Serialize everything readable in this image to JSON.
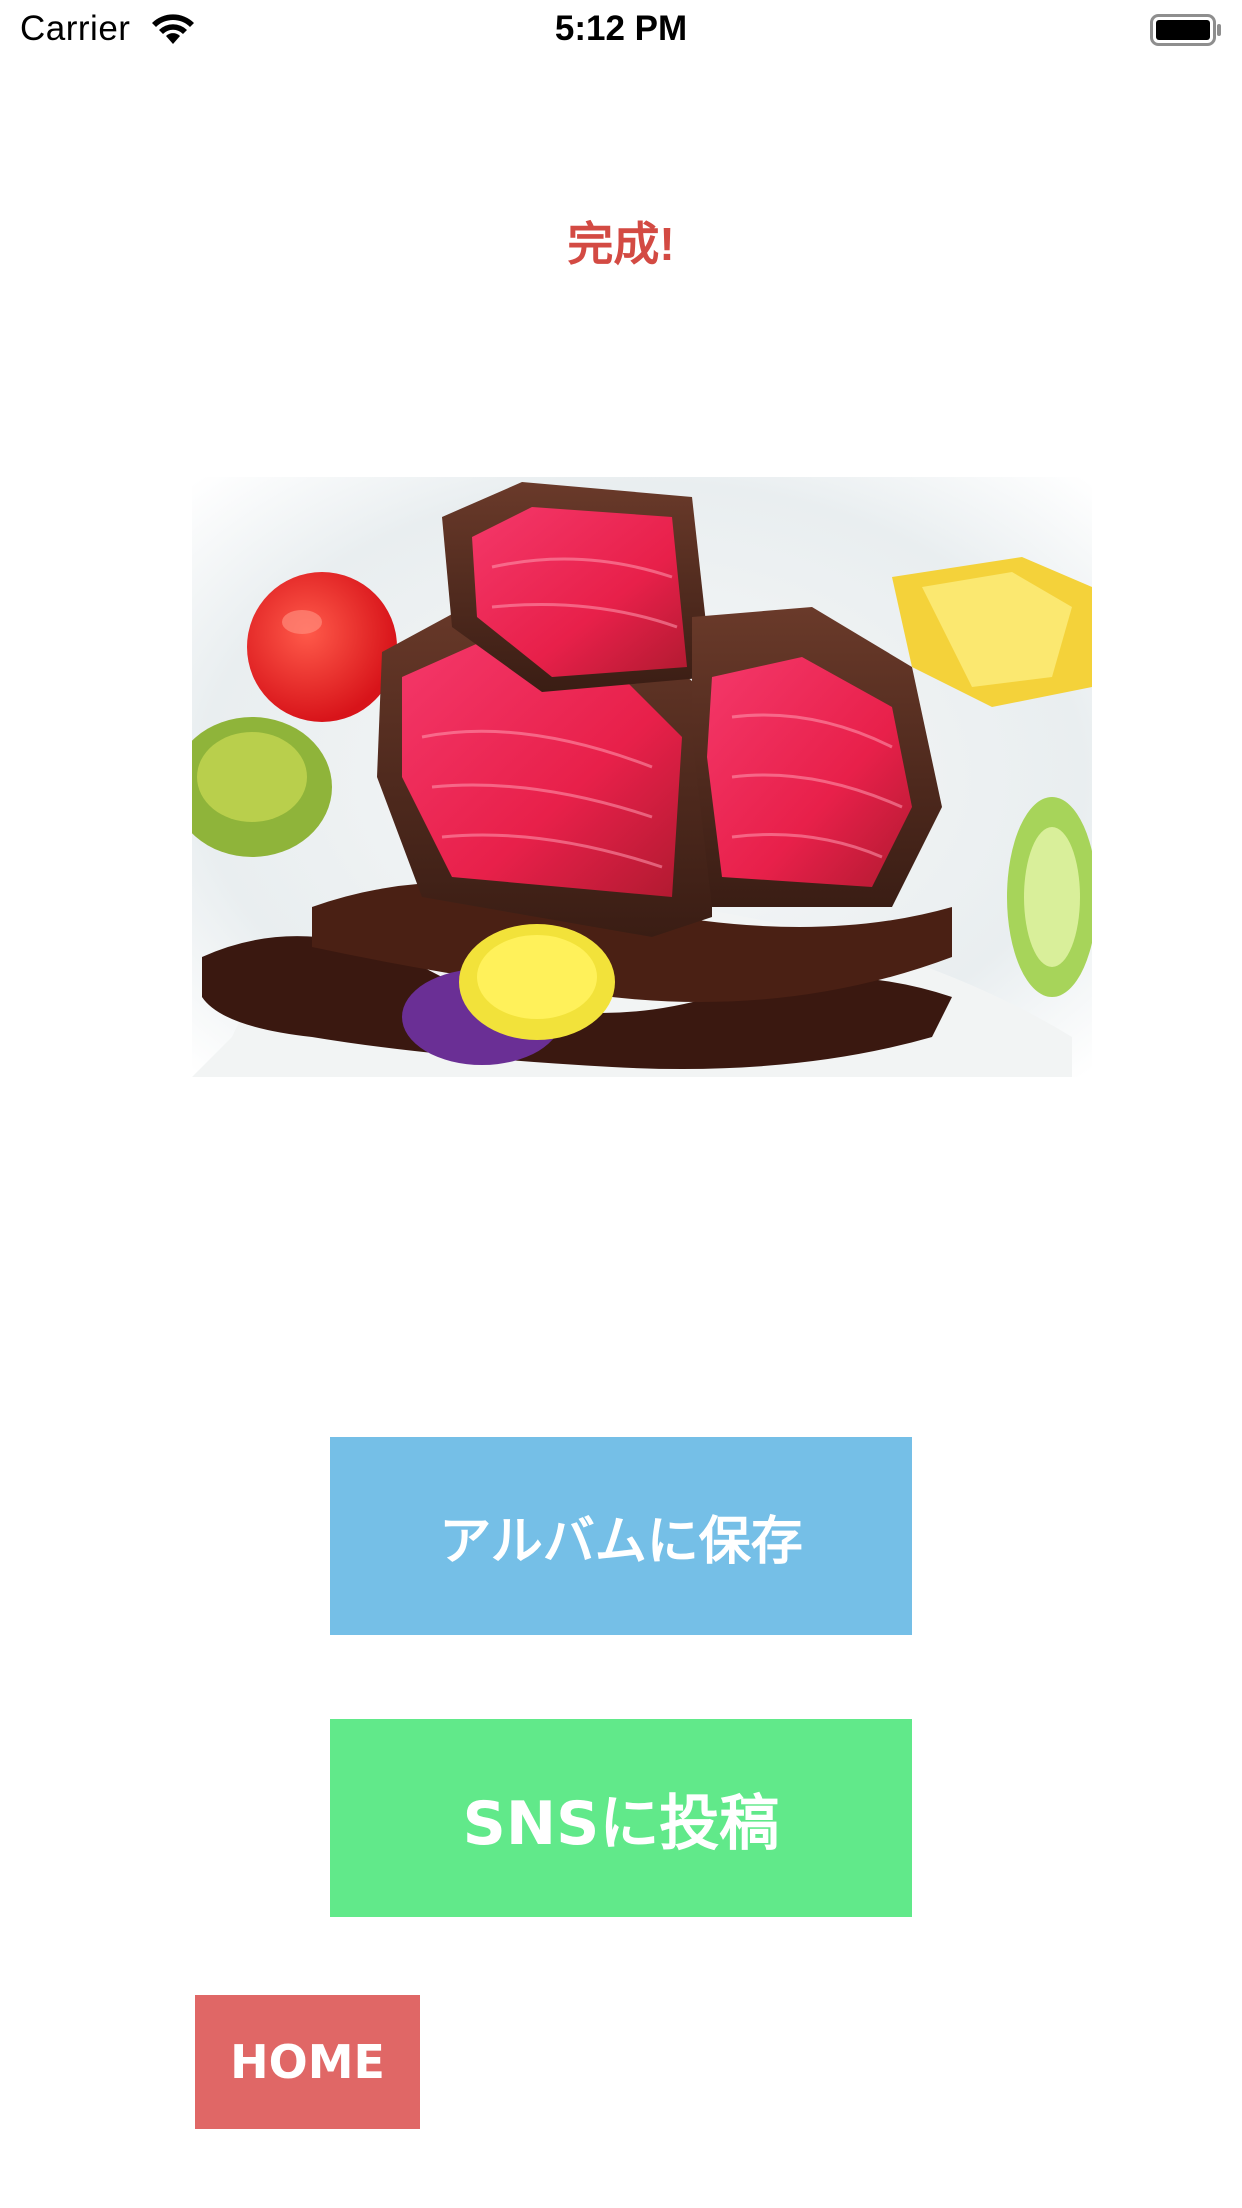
{
  "status_bar": {
    "carrier": "Carrier",
    "time": "5:12 PM",
    "wifi_icon": "wifi-icon",
    "battery_icon": "battery-icon"
  },
  "header": {
    "title": "完成!",
    "title_color": "#d34a43"
  },
  "photo": {
    "subject": "steak-dish-photo"
  },
  "actions": {
    "save_album_label": "アルバムに保存",
    "save_album_color": "#75bfe7",
    "post_sns_label": "SNSに投稿",
    "post_sns_color": "#61e98a",
    "home_label": "HOME",
    "home_color": "#e06766"
  }
}
